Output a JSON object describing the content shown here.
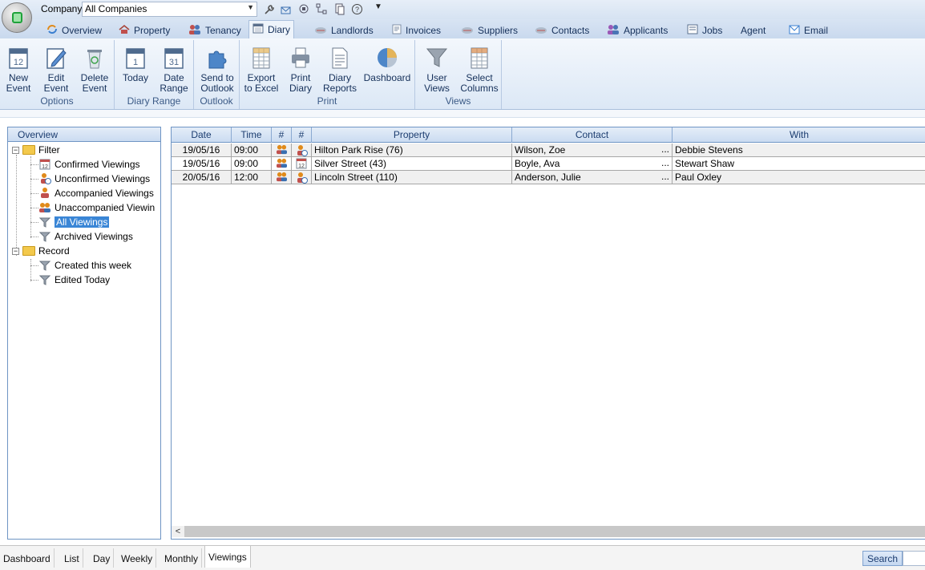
{
  "topbar": {
    "company_label": "Company",
    "company_value": "All Companies",
    "quick_icons": [
      "wrench-icon",
      "email-settings-icon",
      "hierarchy-icon",
      "network-icon",
      "document-copy-icon",
      "help-icon"
    ]
  },
  "tabs": [
    {
      "label": "Overview",
      "icon": "overview-icon",
      "color": "#3a7fd0"
    },
    {
      "label": "Property",
      "icon": "house-icon",
      "color": "#c0504d"
    },
    {
      "label": "Tenancy",
      "icon": "people-icon",
      "color": "#9b59b6"
    },
    {
      "label": "Diary",
      "icon": "calendar-icon",
      "color": "#5a6f8c",
      "active": true
    },
    {
      "label": "Landlords",
      "icon": "landlord-icon",
      "color": "#7f8fa6"
    },
    {
      "label": "Invoices",
      "icon": "invoice-icon",
      "color": "#7f8fa6"
    },
    {
      "label": "Suppliers",
      "icon": "supplier-icon",
      "color": "#7f8fa6"
    },
    {
      "label": "Contacts",
      "icon": "contacts-icon",
      "color": "#c0504d"
    },
    {
      "label": "Applicants",
      "icon": "applicants-icon",
      "color": "#9b59b6"
    },
    {
      "label": "Jobs",
      "icon": "jobs-icon",
      "color": "#5a6f8c"
    },
    {
      "label": "Agent",
      "icon": "",
      "color": ""
    },
    {
      "label": "Email",
      "icon": "email-icon",
      "color": "#3a7fd0"
    }
  ],
  "ribbon": {
    "groups": [
      {
        "label": "Options",
        "buttons": [
          {
            "line1": "New",
            "line2": "Event",
            "icon": "new-event-icon"
          },
          {
            "line1": "Edit",
            "line2": "Event",
            "icon": "edit-event-icon"
          },
          {
            "line1": "Delete",
            "line2": "Event",
            "icon": "recycle-bin-icon"
          }
        ]
      },
      {
        "label": "Diary Range",
        "buttons": [
          {
            "line1": "Today",
            "line2": "",
            "icon": "today-calendar-icon"
          },
          {
            "line1": "Date",
            "line2": "Range",
            "icon": "date-range-calendar-icon"
          }
        ]
      },
      {
        "label": "Outlook",
        "buttons": [
          {
            "line1": "Send to",
            "line2": "Outlook",
            "icon": "puzzle-icon"
          }
        ]
      },
      {
        "label": "Print",
        "buttons": [
          {
            "line1": "Export",
            "line2": "to Excel",
            "icon": "spreadsheet-icon"
          },
          {
            "line1": "Print",
            "line2": "Diary",
            "icon": "printer-icon"
          },
          {
            "line1": "Diary",
            "line2": "Reports",
            "icon": "report-icon"
          },
          {
            "line1": "Dashboard",
            "line2": "",
            "icon": "pie-chart-icon"
          }
        ]
      },
      {
        "label": "Views",
        "buttons": [
          {
            "line1": "User",
            "line2": "Views",
            "icon": "funnel-icon"
          },
          {
            "line1": "Select",
            "line2": "Columns",
            "icon": "columns-grid-icon"
          }
        ]
      }
    ]
  },
  "tree": {
    "header": "Overview",
    "filter_label": "Filter",
    "filter_items": [
      {
        "label": "Confirmed Viewings",
        "icon": "calendar-icon"
      },
      {
        "label": "Unconfirmed  Viewings",
        "icon": "person-clock-icon"
      },
      {
        "label": "Accompanied Viewings",
        "icon": "person-icon"
      },
      {
        "label": "Unaccompanied Viewin",
        "icon": "people-icon"
      },
      {
        "label": "All Viewings",
        "icon": "funnel-icon",
        "selected": true
      },
      {
        "label": "Archived Viewings",
        "icon": "funnel-icon"
      }
    ],
    "record_label": "Record",
    "record_items": [
      {
        "label": "Created this week",
        "icon": "funnel-icon"
      },
      {
        "label": "Edited Today",
        "icon": "funnel-icon"
      }
    ]
  },
  "grid": {
    "columns": [
      "Date",
      "Time",
      "#",
      "#",
      "Property",
      "Contact",
      "With"
    ],
    "rows": [
      {
        "date": "19/05/16",
        "time": "09:00",
        "icon1": "people-icon",
        "icon2": "person-clock-icon",
        "property": "Hilton Park Rise (76)",
        "contact": "Wilson, Zoe",
        "more": "...",
        "with": "Debbie Stevens"
      },
      {
        "date": "19/05/16",
        "time": "09:00",
        "icon1": "people-icon",
        "icon2": "calendar-icon",
        "property": "Silver Street (43)",
        "contact": "Boyle, Ava",
        "more": "...",
        "with": "Stewart Shaw"
      },
      {
        "date": "20/05/16",
        "time": "12:00",
        "icon1": "people-icon",
        "icon2": "person-clock-icon",
        "property": "Lincoln Street (110)",
        "contact": "Anderson, Julie",
        "more": "...",
        "with": "Paul Oxley"
      }
    ]
  },
  "bottom_tabs": [
    "Dashboard",
    "List",
    "Day",
    "Weekly",
    "Monthly",
    "Viewings"
  ],
  "active_bottom_tab": "Viewings",
  "search_label": "Search"
}
